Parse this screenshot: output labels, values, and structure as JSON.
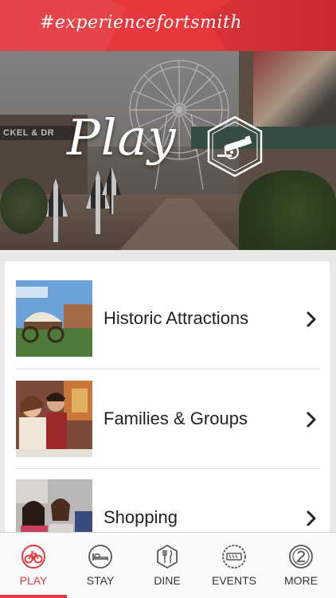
{
  "header": {
    "hashtag": "#experiencefortsmith"
  },
  "hero": {
    "title": "Play",
    "sign_text": "CKEL & DR",
    "icon": "cannon-icon"
  },
  "list": [
    {
      "label": "Historic Attractions",
      "thumb_icon": "covered-wagon-photo"
    },
    {
      "label": "Families & Groups",
      "thumb_icon": "family-group-photo"
    },
    {
      "label": "Shopping",
      "thumb_icon": "shopping-photo"
    }
  ],
  "tabs": [
    {
      "label": "PLAY",
      "icon": "bicycle-icon",
      "active": true
    },
    {
      "label": "STAY",
      "icon": "bed-icon",
      "active": false
    },
    {
      "label": "DINE",
      "icon": "fork-knife-icon",
      "active": false
    },
    {
      "label": "EVENTS",
      "icon": "ticket-icon",
      "active": false
    },
    {
      "label": "MORE",
      "icon": "more-icon",
      "active": false
    }
  ],
  "colors": {
    "accent": "#e23a3f",
    "tab_bar": "#fafafa",
    "background": "#e8e8e8"
  }
}
